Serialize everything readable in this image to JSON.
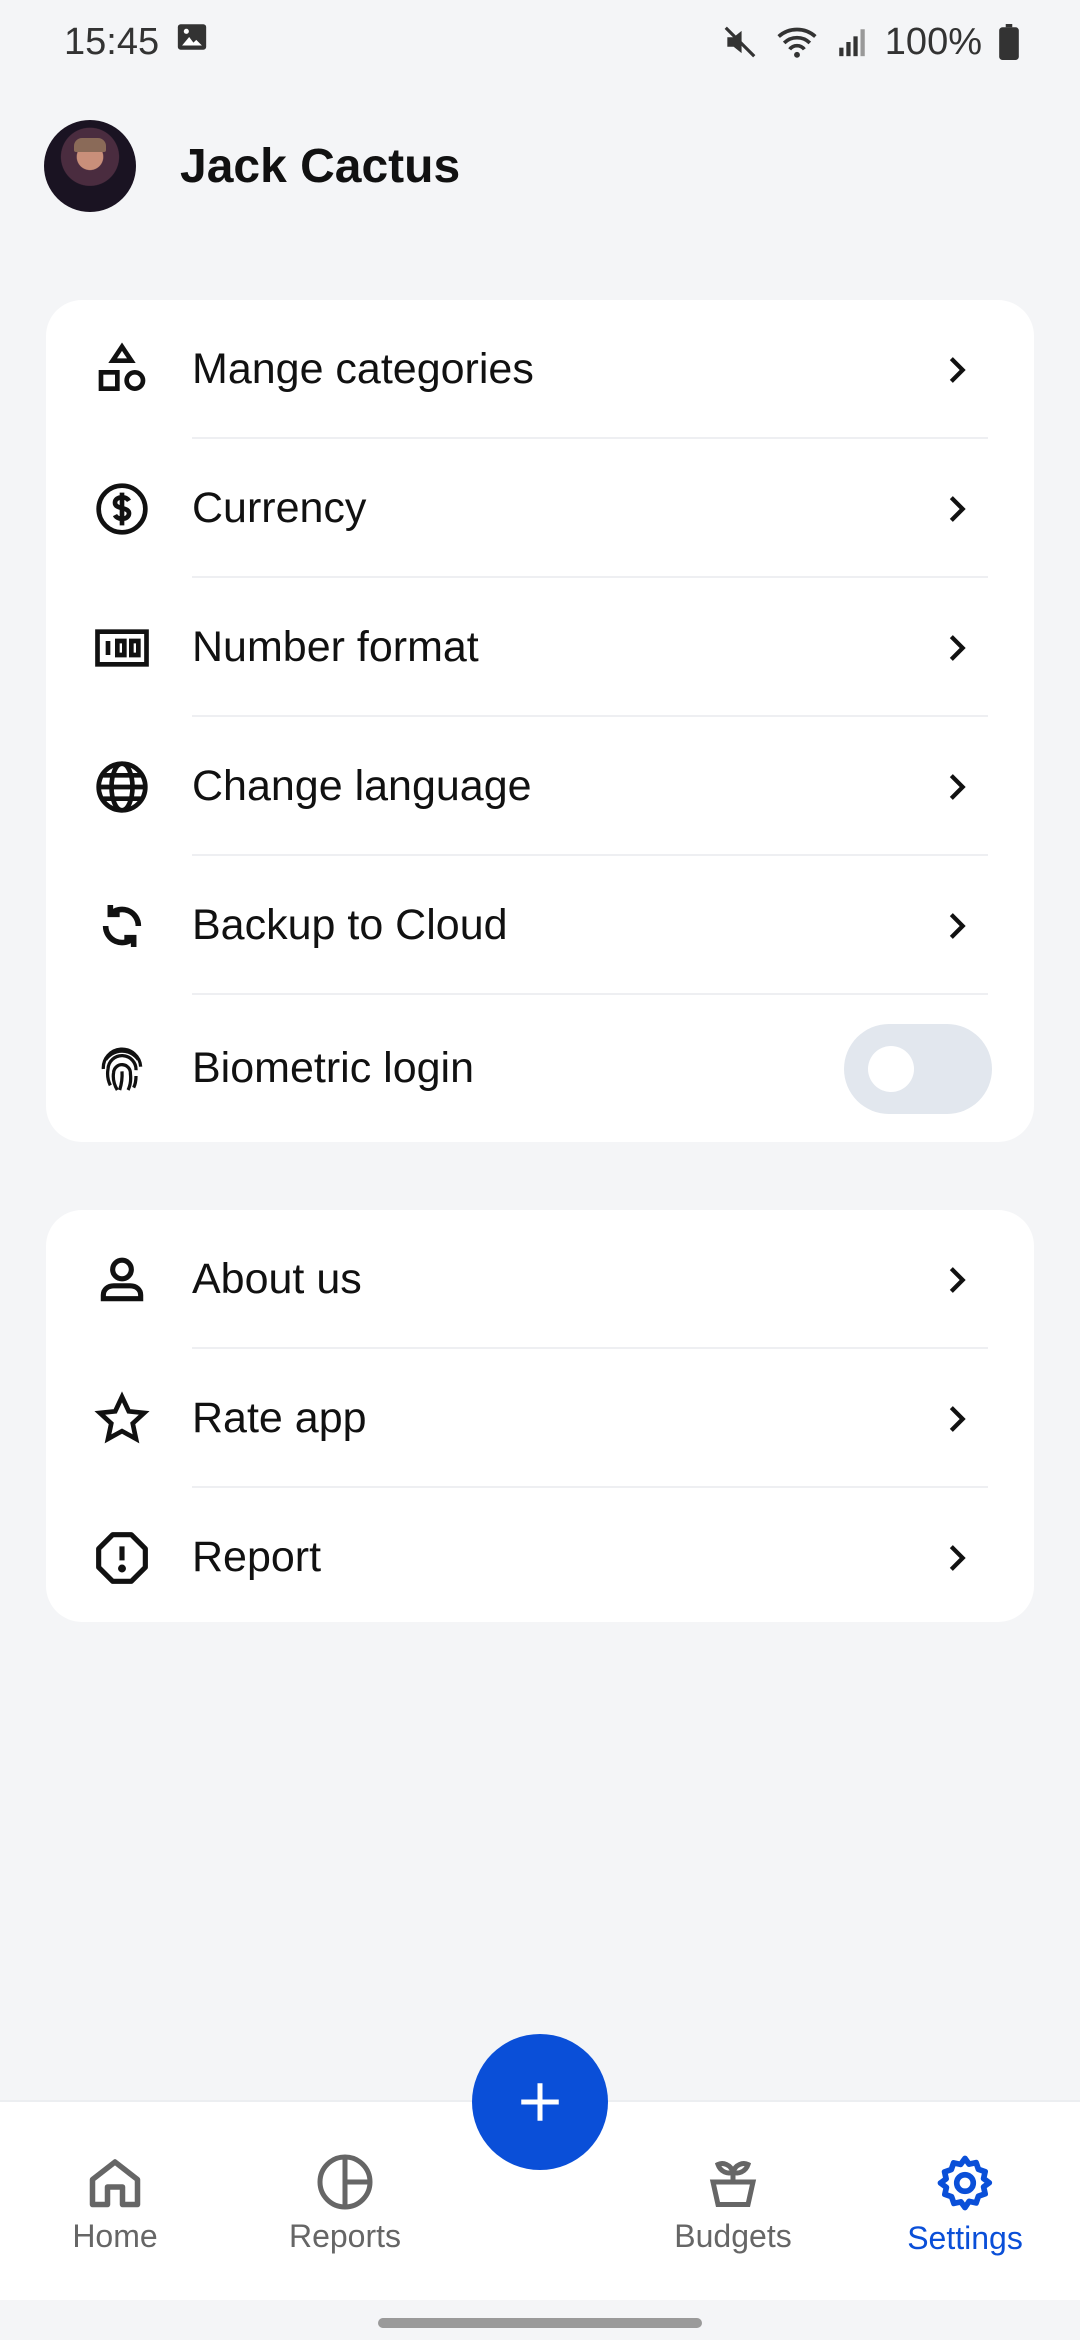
{
  "status_bar": {
    "time": "15:45",
    "battery": "100%",
    "icons": [
      "image-icon",
      "mute-icon",
      "wifi-icon",
      "signal-icon",
      "battery-icon"
    ]
  },
  "profile": {
    "name": "Jack Cactus"
  },
  "settings_group_1": [
    {
      "label": "Mange categories",
      "icon": "shapes-icon"
    },
    {
      "label": "Currency",
      "icon": "dollar-circle-icon"
    },
    {
      "label": "Number format",
      "icon": "number-format-icon"
    },
    {
      "label": "Change language",
      "icon": "globe-icon"
    },
    {
      "label": "Backup to Cloud",
      "icon": "sync-icon"
    },
    {
      "label": "Biometric login",
      "icon": "fingerprint-icon",
      "toggle": false
    }
  ],
  "settings_group_2": [
    {
      "label": "About us",
      "icon": "user-icon"
    },
    {
      "label": "Rate app",
      "icon": "star-icon"
    },
    {
      "label": "Report",
      "icon": "alert-octagon-icon"
    }
  ],
  "bottom_nav": {
    "items": [
      {
        "label": "Home",
        "icon": "home-icon"
      },
      {
        "label": "Reports",
        "icon": "pie-chart-icon"
      },
      {
        "label": "Budgets",
        "icon": "plant-pot-icon"
      },
      {
        "label": "Settings",
        "icon": "gear-icon",
        "active": true
      }
    ],
    "fab_icon": "plus-icon"
  },
  "colors": {
    "accent": "#0a4fd8",
    "background": "#f4f5f7",
    "card": "#ffffff",
    "toggle_off": "#e2e7ee"
  }
}
